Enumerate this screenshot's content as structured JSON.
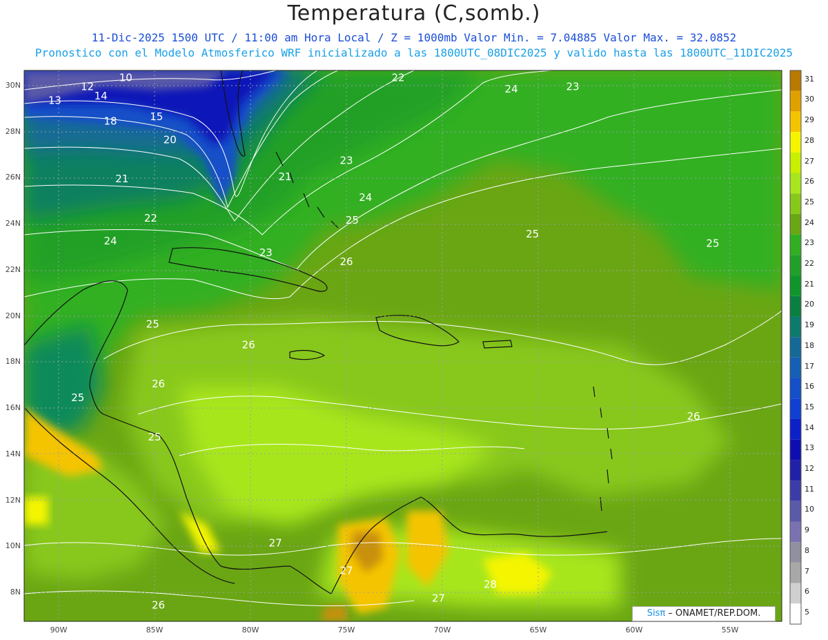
{
  "title": "Temperatura (C,somb.)",
  "subtitle_line1": "11-Dic-2025 1500 UTC / 11:00 am Hora Local / Z = 1000mb  Valor Min. = 7.04885  Valor Max. = 32.0852",
  "subtitle_line2": "Pronostico con el Modelo Atmosferico WRF inicializado a las 1800UTC_08DIC2025 y valido hasta las  1800UTC_11DIC2025",
  "credit_sis": "Sisπ",
  "credit_rest": " – ONAMET/REP.DOM.",
  "latitude_ticks": [
    "30N",
    "28N",
    "26N",
    "24N",
    "22N",
    "20N",
    "18N",
    "16N",
    "14N",
    "12N",
    "10N",
    "8N"
  ],
  "longitude_ticks": [
    "90W",
    "85W",
    "80W",
    "75W",
    "70W",
    "65W",
    "60W",
    "55W"
  ],
  "colorbar": {
    "labels": [
      "31",
      "30",
      "29",
      "28",
      "27",
      "26",
      "25",
      "24",
      "23",
      "22",
      "21",
      "20",
      "19",
      "18",
      "17",
      "16",
      "15",
      "14",
      "13",
      "12",
      "11",
      "10",
      "9",
      "8",
      "7",
      "6",
      "5"
    ],
    "colors": [
      "#b87a00",
      "#e0a000",
      "#f5c400",
      "#f5f500",
      "#c8f000",
      "#a8e61e",
      "#88c81a",
      "#6aa614",
      "#30b020",
      "#20a028",
      "#10952a",
      "#0a8040",
      "#0e7a6e",
      "#136a96",
      "#1560b4",
      "#1450c8",
      "#1040d2",
      "#0c20c8",
      "#0e0eb0",
      "#2020a8",
      "#3c3ca8",
      "#5a5aa8",
      "#7a72b0",
      "#9090a0",
      "#a8a8a8",
      "#d0d0d0",
      "#ffffff"
    ]
  },
  "contour_labels": [
    {
      "text": "10",
      "lon": -86.5,
      "lat": 30.2
    },
    {
      "text": "12",
      "lon": -88.5,
      "lat": 29.8
    },
    {
      "text": "13",
      "lon": -90.2,
      "lat": 29.2
    },
    {
      "text": "14",
      "lon": -87.8,
      "lat": 29.4
    },
    {
      "text": "15",
      "lon": -84.9,
      "lat": 28.5
    },
    {
      "text": "18",
      "lon": -87.3,
      "lat": 28.3
    },
    {
      "text": "20",
      "lon": -84.2,
      "lat": 27.5
    },
    {
      "text": "21",
      "lon": -86.7,
      "lat": 25.8
    },
    {
      "text": "21",
      "lon": -78.2,
      "lat": 25.9
    },
    {
      "text": "22",
      "lon": -85.2,
      "lat": 24.1
    },
    {
      "text": "22",
      "lon": -72.3,
      "lat": 30.2
    },
    {
      "text": "23",
      "lon": -79.2,
      "lat": 22.6
    },
    {
      "text": "23",
      "lon": -75.0,
      "lat": 26.6
    },
    {
      "text": "23",
      "lon": -63.2,
      "lat": 29.8
    },
    {
      "text": "24",
      "lon": -87.3,
      "lat": 23.1
    },
    {
      "text": "24",
      "lon": -66.4,
      "lat": 29.7
    },
    {
      "text": "24",
      "lon": -74.0,
      "lat": 25.0
    },
    {
      "text": "25",
      "lon": -74.7,
      "lat": 24.0
    },
    {
      "text": "25",
      "lon": -85.1,
      "lat": 19.5
    },
    {
      "text": "25",
      "lon": -89.0,
      "lat": 16.3
    },
    {
      "text": "25",
      "lon": -85.0,
      "lat": 14.6
    },
    {
      "text": "25",
      "lon": -65.3,
      "lat": 23.4
    },
    {
      "text": "25",
      "lon": -55.9,
      "lat": 23.0
    },
    {
      "text": "26",
      "lon": -75.0,
      "lat": 22.2
    },
    {
      "text": "26",
      "lon": -80.1,
      "lat": 18.6
    },
    {
      "text": "26",
      "lon": -84.8,
      "lat": 16.9
    },
    {
      "text": "26",
      "lon": -56.9,
      "lat": 15.5
    },
    {
      "text": "26",
      "lon": -84.8,
      "lat": 7.3
    },
    {
      "text": "27",
      "lon": -78.7,
      "lat": 10.0
    },
    {
      "text": "27",
      "lon": -75.0,
      "lat": 8.8
    },
    {
      "text": "27",
      "lon": -70.2,
      "lat": 7.6
    },
    {
      "text": "28",
      "lon": -67.5,
      "lat": 8.2
    }
  ]
}
